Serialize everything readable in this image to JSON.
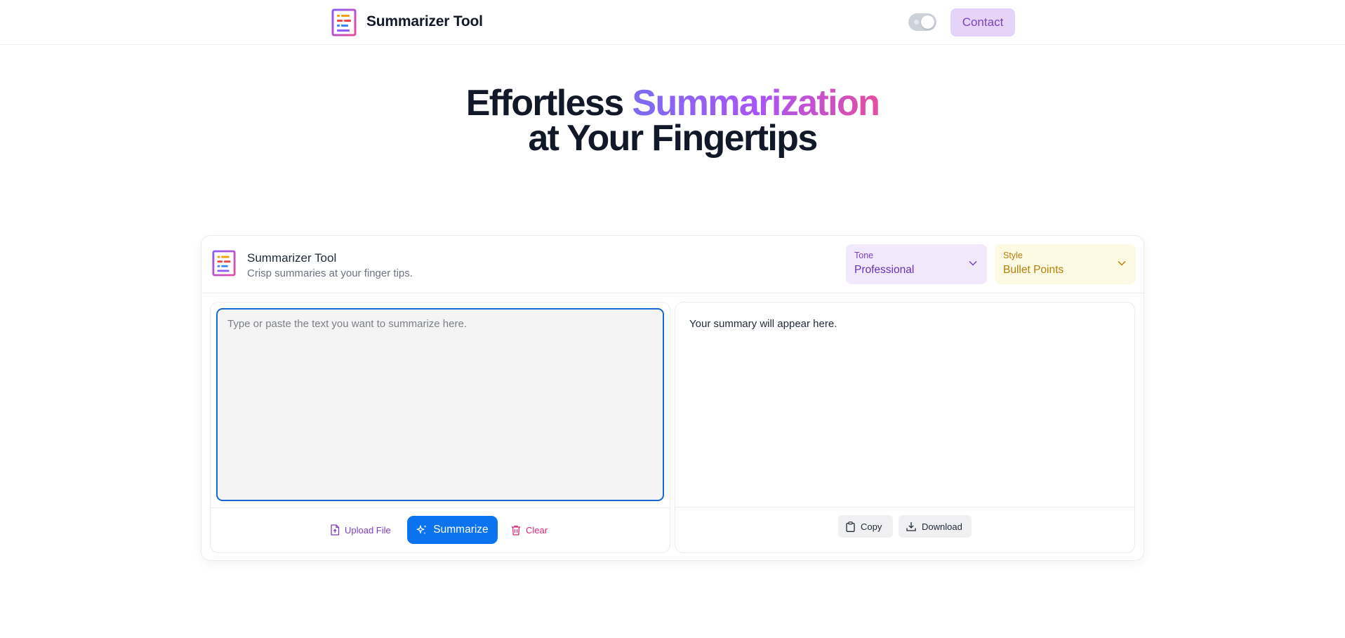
{
  "navbar": {
    "title": "Summarizer Tool",
    "logo_icon": "document-list-icon",
    "theme_toggle_icon": "toggle-icon",
    "contact_label": "Contact"
  },
  "hero": {
    "line1_plain": "Effortless ",
    "line1_highlight": "Summarization",
    "line2": "at Your Fingertips"
  },
  "card": {
    "title": "Summarizer Tool",
    "subtitle": "Crisp summaries at your finger tips.",
    "tone": {
      "label": "Tone",
      "value": "Professional",
      "icon": "chevron-down-icon"
    },
    "style": {
      "label": "Style",
      "value": "Bullet Points",
      "icon": "chevron-down-icon"
    }
  },
  "input": {
    "placeholder": "Type or paste the text you want to summarize here.",
    "value": "",
    "upload_label": "Upload File",
    "summarize_label": "Summarize",
    "clear_label": "Clear"
  },
  "output": {
    "placeholder_text": "Your summary will appear here.",
    "copy_label": "Copy",
    "download_label": "Download"
  },
  "colors": {
    "primary": "#0b73ee",
    "accent_purple": "#7e3fc2",
    "accent_pink": "#db2777",
    "accent_amber": "#b47f0a",
    "gradient": [
      "#7c6cf2",
      "#a855f7",
      "#e44ea0"
    ]
  }
}
